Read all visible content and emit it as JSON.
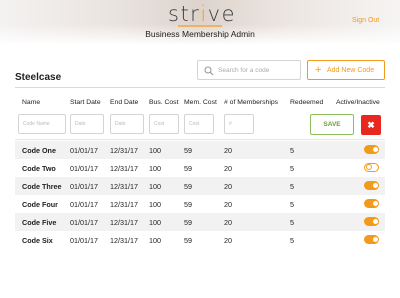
{
  "header": {
    "logo_pre": "str",
    "logo_i": "i",
    "logo_post": "ve",
    "app_title": "Business Membership Admin",
    "sign_out": "Sign Out"
  },
  "colors": {
    "accent": "#f39a1c",
    "save_green": "#6a9f36",
    "danger": "#e8271f",
    "row_alt": "#f2f2f2"
  },
  "section": {
    "title": "Steelcase"
  },
  "search": {
    "placeholder": "Search for a code",
    "icon": "search-icon"
  },
  "add_button": {
    "icon": "plus-icon",
    "label": "Add New Code"
  },
  "columns": [
    "Name",
    "Start Date",
    "End Date",
    "Bus. Cost",
    "Mem. Cost",
    "# of Memberships",
    "Redeemed",
    "Active/Inactive"
  ],
  "new_row": {
    "placeholders": [
      "Code Name",
      "Date",
      "Date",
      "Cost",
      "Cost",
      "#"
    ],
    "save_label": "SAVE",
    "cancel_icon": "close-icon",
    "cancel_label": "✖"
  },
  "rows": [
    {
      "name": "Code One",
      "start": "01/01/17",
      "end": "12/31/17",
      "bus": "100",
      "mem": "59",
      "num": "20",
      "redeemed": "5",
      "active": true
    },
    {
      "name": "Code Two",
      "start": "01/01/17",
      "end": "12/31/17",
      "bus": "100",
      "mem": "59",
      "num": "20",
      "redeemed": "5",
      "active": false
    },
    {
      "name": "Code Three",
      "start": "01/01/17",
      "end": "12/31/17",
      "bus": "100",
      "mem": "59",
      "num": "20",
      "redeemed": "5",
      "active": true
    },
    {
      "name": "Code Four",
      "start": "01/01/17",
      "end": "12/31/17",
      "bus": "100",
      "mem": "59",
      "num": "20",
      "redeemed": "5",
      "active": true
    },
    {
      "name": "Code Five",
      "start": "01/01/17",
      "end": "12/31/17",
      "bus": "100",
      "mem": "59",
      "num": "20",
      "redeemed": "5",
      "active": true
    },
    {
      "name": "Code Six",
      "start": "01/01/17",
      "end": "12/31/17",
      "bus": "100",
      "mem": "59",
      "num": "20",
      "redeemed": "5",
      "active": true
    }
  ]
}
